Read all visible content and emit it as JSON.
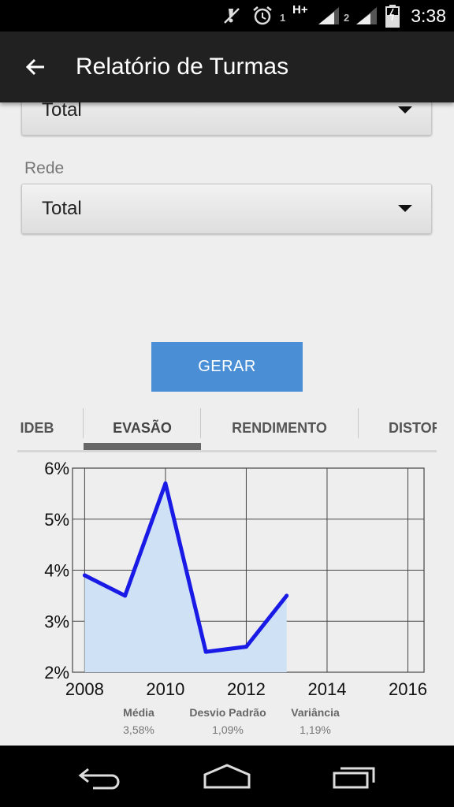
{
  "status_bar": {
    "time": "3:38",
    "sim1_label": "1",
    "sim2_label": "2",
    "network_label": "H+",
    "icons": [
      "mute-icon",
      "alarm-icon",
      "signal-icon",
      "battery-icon"
    ]
  },
  "app_bar": {
    "title": "Relatório de Turmas",
    "back_icon": "arrow-left-icon"
  },
  "form": {
    "top_spinner_value": "Total",
    "rede_label": "Rede",
    "rede_value": "Total",
    "submit_label": "GERAR"
  },
  "tabs": [
    {
      "label": "IDEB",
      "selected": false
    },
    {
      "label": "EVASÃO",
      "selected": true
    },
    {
      "label": "RENDIMENTO",
      "selected": false
    },
    {
      "label": "DISTORÇÃO",
      "selected": false
    }
  ],
  "chart_data": {
    "type": "area",
    "x": [
      2008,
      2009,
      2010,
      2011,
      2012,
      2013
    ],
    "series": [
      {
        "values": [
          3.9,
          3.5,
          5.7,
          2.4,
          2.5,
          3.5
        ]
      }
    ],
    "xlim": [
      2007.7,
      2016.4
    ],
    "ylim": [
      2,
      6
    ],
    "x_ticks": [
      "2008",
      "2010",
      "2012",
      "2014",
      "2016"
    ],
    "y_ticks": [
      "2%",
      "3%",
      "4%",
      "5%",
      "6%"
    ],
    "grid": true,
    "line_color": "#1a1ae6",
    "fill_color": "#cfe2f5"
  },
  "stats": [
    {
      "label": "Média",
      "value": "3,58%"
    },
    {
      "label": "Desvio Padrão",
      "value": "1,09%"
    },
    {
      "label": "Variância",
      "value": "1,19%"
    }
  ],
  "nav_bar": {
    "icons": [
      "back-nav-icon",
      "home-nav-icon",
      "recents-nav-icon"
    ]
  }
}
